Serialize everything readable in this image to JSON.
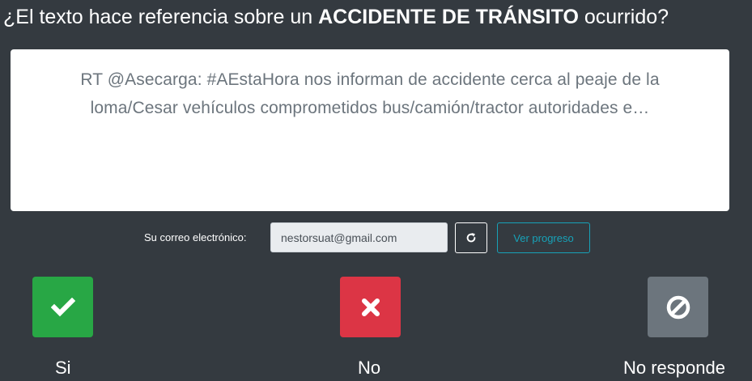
{
  "question": {
    "prefix": "¿El texto hace referencia sobre un ",
    "emphasis": "ACCIDENTE DE TRÁNSITO",
    "suffix": " ocurrido?"
  },
  "tweet": {
    "text": "RT @Asecarga: #AEstaHora nos informan de accidente cerca al peaje de la loma/Cesar vehículos comprometidos bus/camión/tractor autoridades e…"
  },
  "email": {
    "label": "Su correo electrónico:",
    "value": "nestorsuat@gmail.com"
  },
  "buttons": {
    "refresh_icon": "refresh-icon",
    "progress_label": "Ver progreso"
  },
  "answers": {
    "yes": {
      "label": "Si",
      "icon": "check-icon",
      "color": "#28a745"
    },
    "no": {
      "label": "No",
      "icon": "times-icon",
      "color": "#dc3545"
    },
    "no_answer": {
      "label": "No responde",
      "icon": "ban-icon",
      "color": "#6c757d"
    }
  },
  "colors": {
    "background": "#343a40",
    "accent_info": "#17a2b8"
  }
}
